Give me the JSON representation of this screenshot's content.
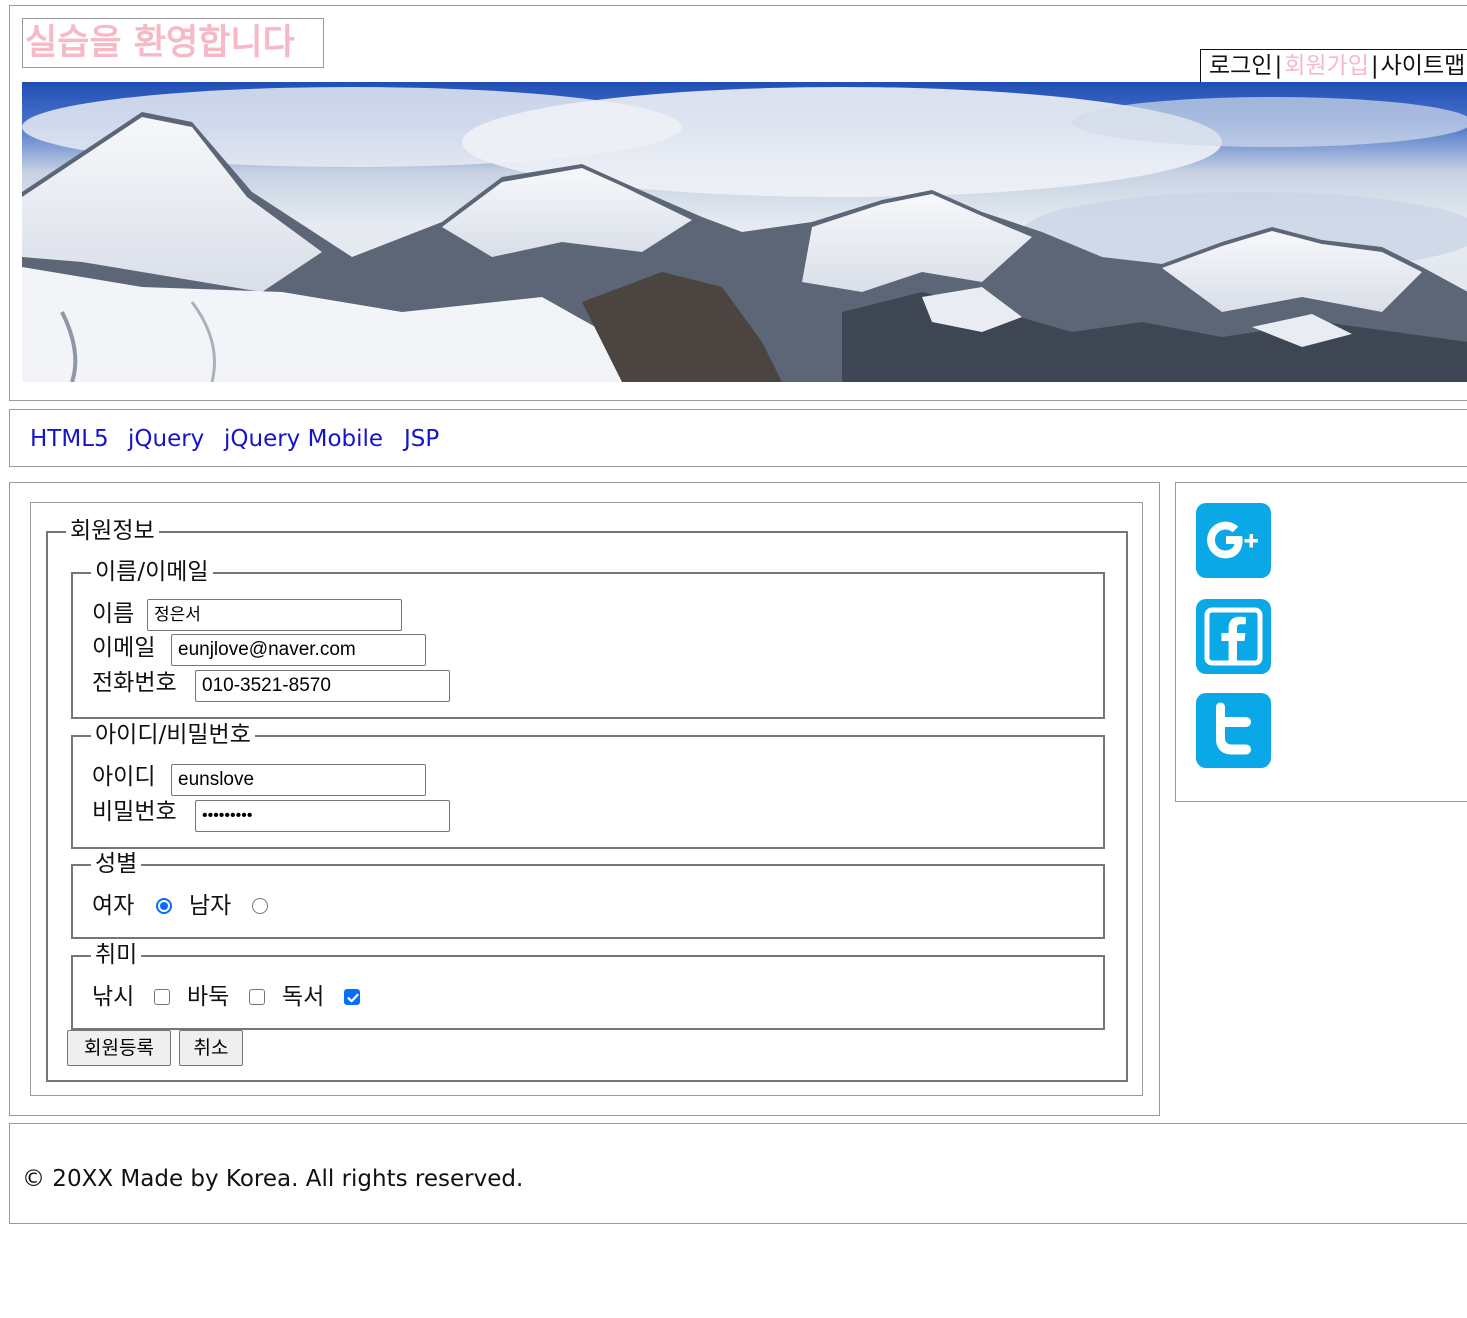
{
  "header": {
    "logo_text": "실습을 환영합니다",
    "top_nav": [
      {
        "label": "로그인"
      },
      {
        "label": "회원가입"
      },
      {
        "label": "사이트맵"
      }
    ],
    "separator": "|"
  },
  "nav": {
    "items": [
      {
        "label": "HTML5"
      },
      {
        "label": "jQuery"
      },
      {
        "label": "jQuery Mobile"
      },
      {
        "label": "JSP"
      }
    ]
  },
  "form": {
    "legend": "회원정보",
    "name_email": {
      "legend": "이름/이메일",
      "name_label": "이름",
      "name_value": "정은서",
      "email_label": "이메일",
      "email_value": "eunjlove@naver.com",
      "phone_label": "전화번호",
      "phone_value": "010-3521-8570"
    },
    "account": {
      "legend": "아이디/비밀번호",
      "id_label": "아이디",
      "id_value": "eunslove",
      "password_label": "비밀번호",
      "password_value": "•••••••••"
    },
    "gender": {
      "legend": "성별",
      "female_label": "여자",
      "male_label": "남자",
      "selected": "여자"
    },
    "hobby": {
      "legend": "취미",
      "options": [
        {
          "label": "낚시",
          "checked": false
        },
        {
          "label": "바둑",
          "checked": false
        },
        {
          "label": "독서",
          "checked": true
        }
      ]
    },
    "submit_label": "회원등록",
    "cancel_label": "취소"
  },
  "aside": {
    "icons": [
      "google-plus-icon",
      "facebook-icon",
      "twitter-icon"
    ],
    "icon_color": "#0aa8e6"
  },
  "footer": {
    "copyright": "© 20XX Made by Korea. All rights reserved."
  },
  "colors": {
    "logo": "#f6b9c5",
    "nav_link": "#1414c8",
    "active_top_nav": "#f6b9c5",
    "check_accent": "#0a6cff"
  }
}
